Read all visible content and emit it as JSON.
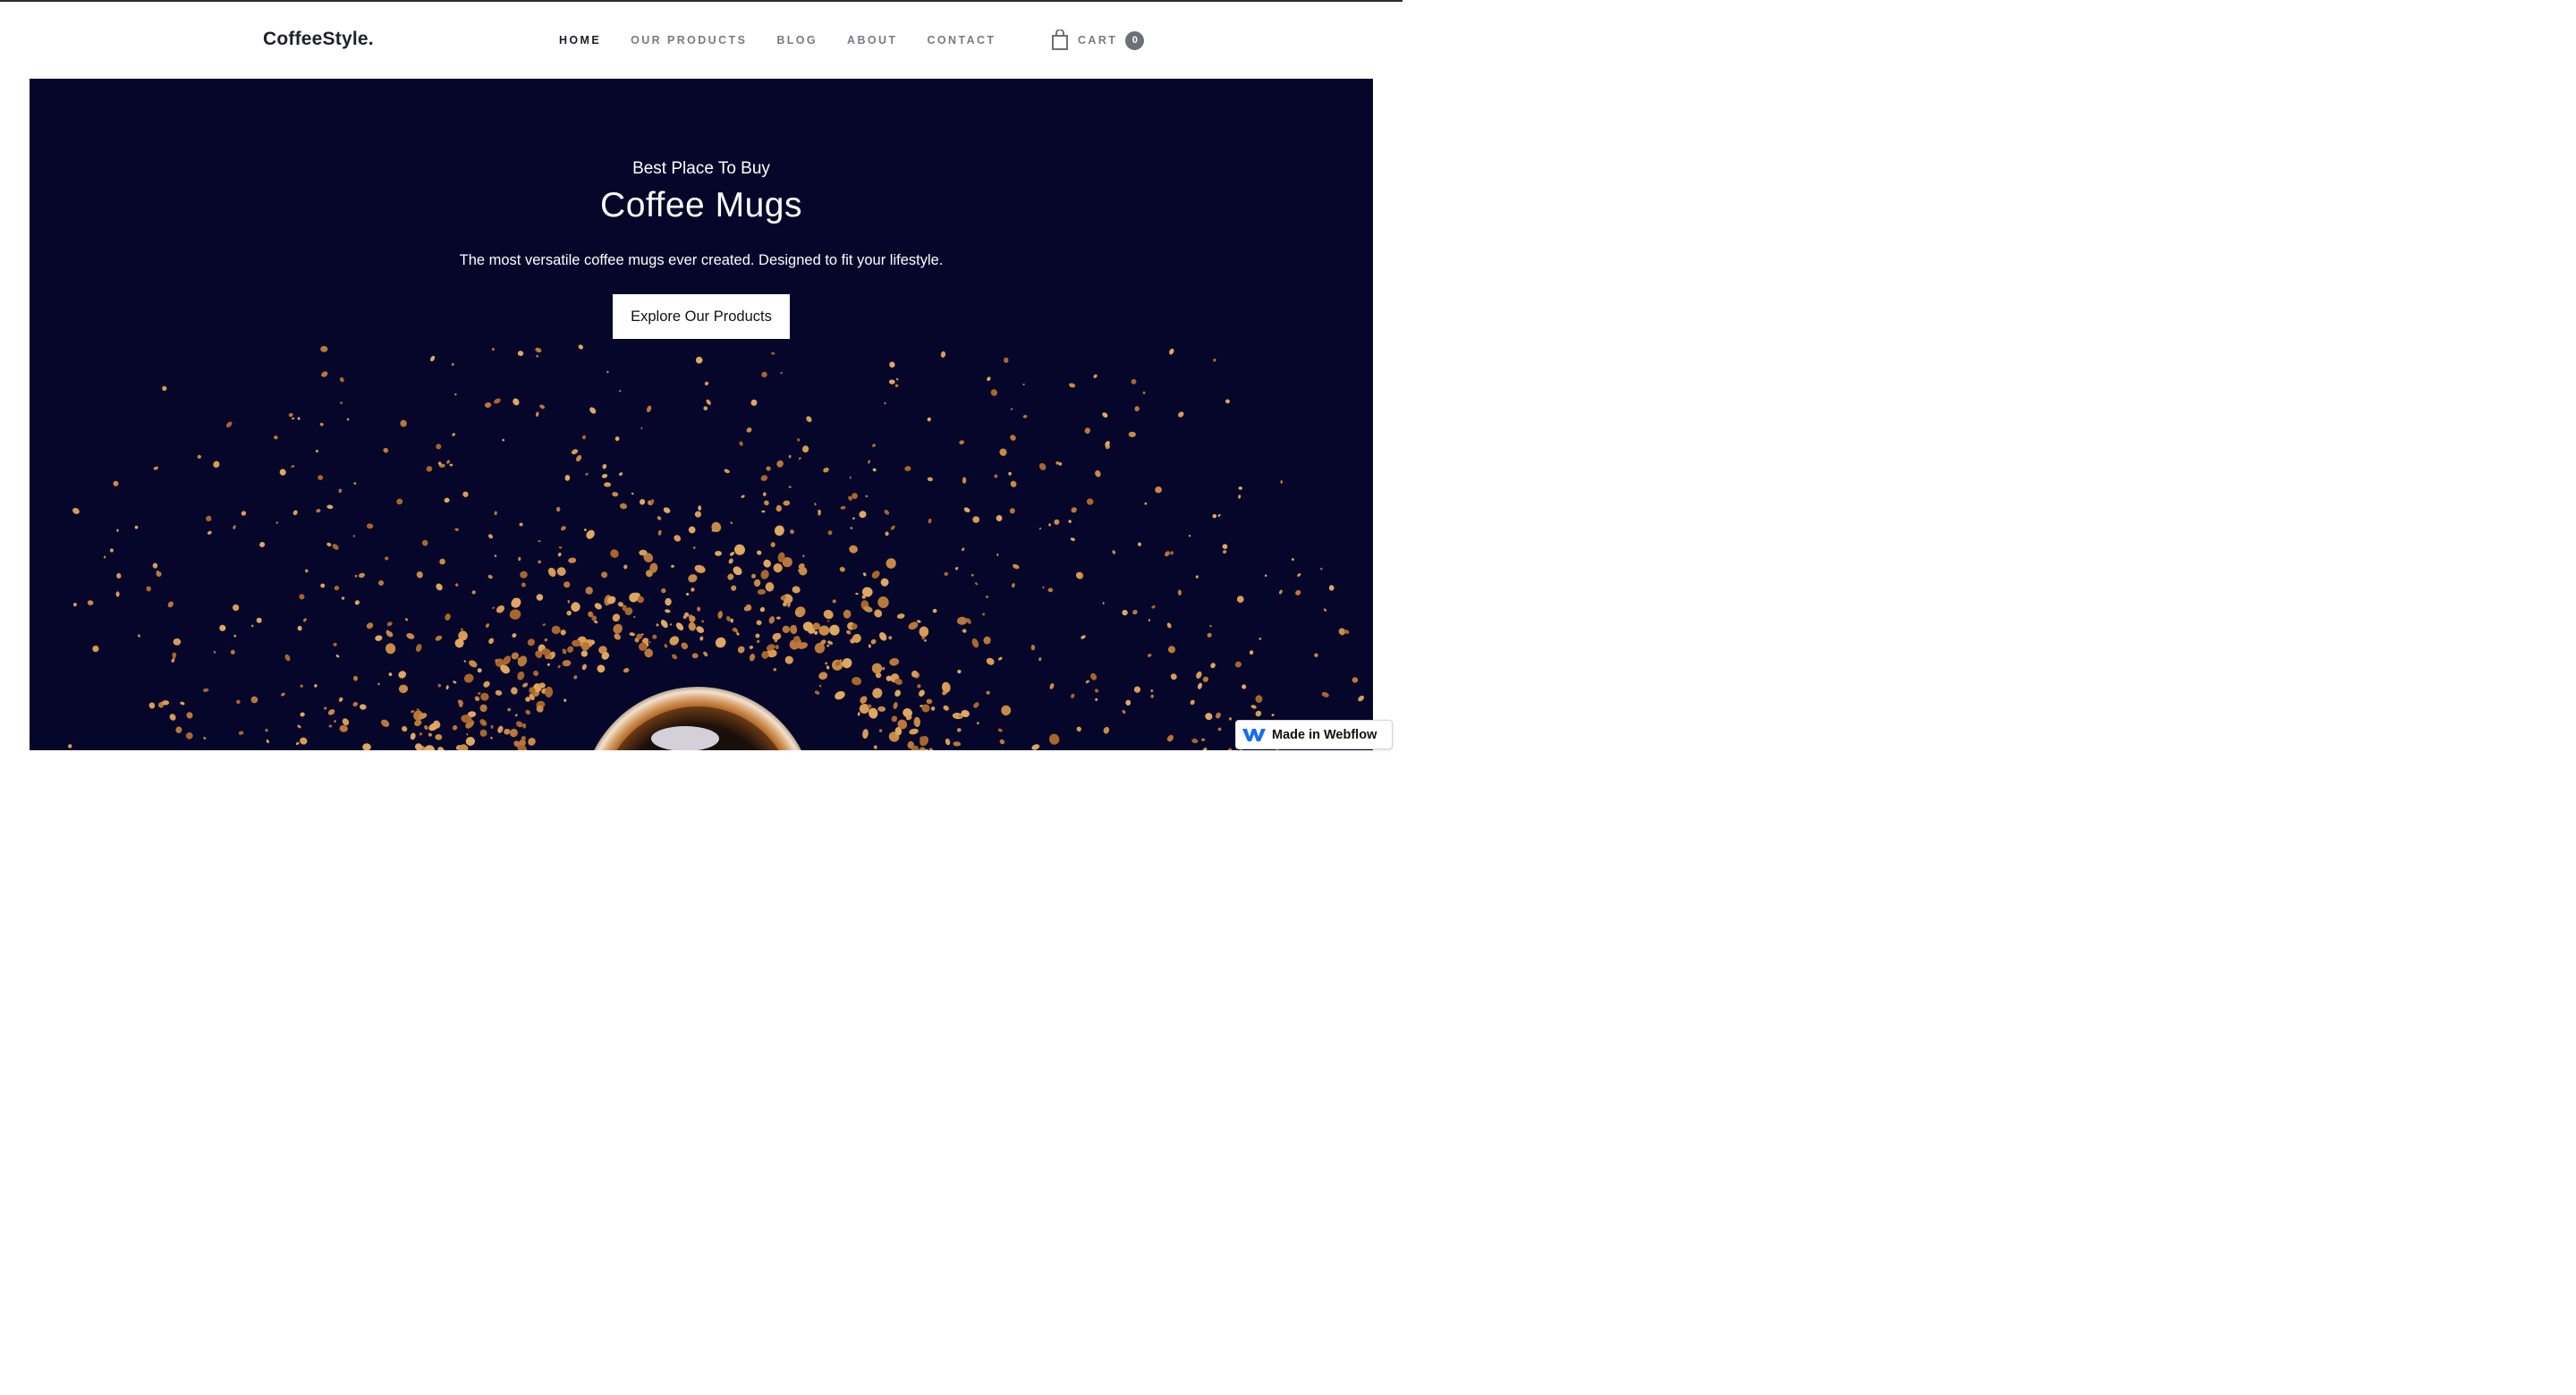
{
  "brand": {
    "name": "CoffeeStyle."
  },
  "nav": {
    "items": [
      {
        "label": "HOME",
        "active": true
      },
      {
        "label": "OUR PRODUCTS",
        "active": false
      },
      {
        "label": "BLOG",
        "active": false
      },
      {
        "label": "ABOUT",
        "active": false
      },
      {
        "label": "CONTACT",
        "active": false
      }
    ]
  },
  "cart": {
    "label": "CART",
    "count": "0",
    "icon": "shopping-bag-icon"
  },
  "hero": {
    "eyebrow": "Best Place To Buy",
    "headline": "Coffee Mugs",
    "subline": "The most versatile coffee mugs ever created. Designed to fit your lifestyle.",
    "cta_label": "Explore Our Products",
    "background_color": "#05062a",
    "granule_color": "#c98a45"
  },
  "badge": {
    "label": "Made in Webflow",
    "icon": "webflow-logo-icon",
    "accent": "#146ef5"
  }
}
